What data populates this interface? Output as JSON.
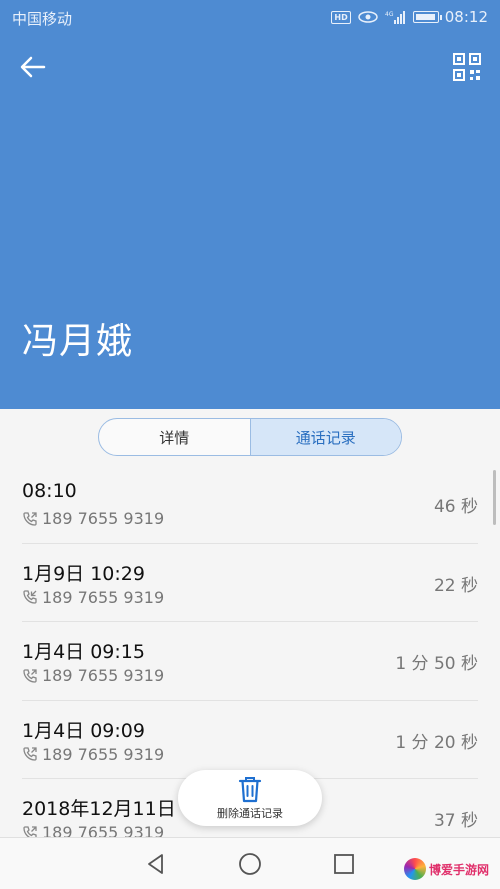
{
  "status": {
    "carrier": "中国移动",
    "time": "08:12",
    "hd": "HD",
    "network": "4G"
  },
  "header": {
    "contact_name": "冯月娥"
  },
  "tabs": [
    {
      "label": "详情",
      "active": false
    },
    {
      "label": "通话记录",
      "active": true
    }
  ],
  "calls": [
    {
      "time": "08:10",
      "phone": "189 7655 9319",
      "duration": "46 秒"
    },
    {
      "time": "1月9日 10:29",
      "phone": "189 7655 9319",
      "duration": "22 秒"
    },
    {
      "time": "1月4日 09:15",
      "phone": "189 7655 9319",
      "duration": "1 分 50 秒"
    },
    {
      "time": "1月4日 09:09",
      "phone": "189 7655 9319",
      "duration": "1 分 20 秒"
    },
    {
      "time": "2018年12月11日",
      "phone": "189 7655 9319",
      "duration": "37 秒"
    }
  ],
  "actions": {
    "delete_label": "删除通话记录"
  },
  "watermark": {
    "text": "博爱手游网"
  },
  "colors": {
    "header_bg": "#4e8bd2",
    "tab_active_bg": "#d6e6f8",
    "accent": "#2a6fc0",
    "trash_icon": "#1e6fd0"
  }
}
